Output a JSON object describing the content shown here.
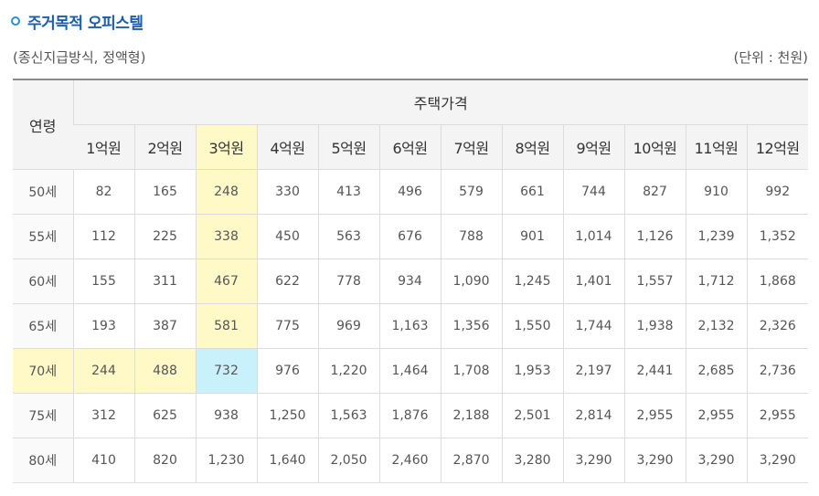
{
  "title": "주거목적 오피스텔",
  "subtitle": "(종신지급방식, 정액형)",
  "unit": "(단위 : 천원)",
  "table": {
    "age_header": "연령",
    "price_header": "주택가격",
    "columns": [
      "1억원",
      "2억원",
      "3억원",
      "4억원",
      "5억원",
      "6억원",
      "7억원",
      "8억원",
      "9억원",
      "10억원",
      "11억원",
      "12억원"
    ],
    "rows": [
      {
        "age": "50세",
        "values": [
          "82",
          "165",
          "248",
          "330",
          "413",
          "496",
          "579",
          "661",
          "744",
          "827",
          "910",
          "992"
        ]
      },
      {
        "age": "55세",
        "values": [
          "112",
          "225",
          "338",
          "450",
          "563",
          "676",
          "788",
          "901",
          "1,014",
          "1,126",
          "1,239",
          "1,352"
        ]
      },
      {
        "age": "60세",
        "values": [
          "155",
          "311",
          "467",
          "622",
          "778",
          "934",
          "1,090",
          "1,245",
          "1,401",
          "1,557",
          "1,712",
          "1,868"
        ]
      },
      {
        "age": "65세",
        "values": [
          "193",
          "387",
          "581",
          "775",
          "969",
          "1,163",
          "1,356",
          "1,550",
          "1,744",
          "1,938",
          "2,132",
          "2,326"
        ]
      },
      {
        "age": "70세",
        "values": [
          "244",
          "488",
          "732",
          "976",
          "1,220",
          "1,464",
          "1,708",
          "1,953",
          "2,197",
          "2,441",
          "2,685",
          "2,736"
        ]
      },
      {
        "age": "75세",
        "values": [
          "312",
          "625",
          "938",
          "1,250",
          "1,563",
          "1,876",
          "2,188",
          "2,501",
          "2,814",
          "2,955",
          "2,955",
          "2,955"
        ]
      },
      {
        "age": "80세",
        "values": [
          "410",
          "820",
          "1,230",
          "1,640",
          "2,050",
          "2,460",
          "2,870",
          "3,280",
          "3,290",
          "3,290",
          "3,290",
          "3,290"
        ]
      }
    ]
  },
  "colors": {
    "title": "#1b5eab",
    "highlight_yellow": "#fef9c7",
    "highlight_blue": "#c9f1fb"
  }
}
